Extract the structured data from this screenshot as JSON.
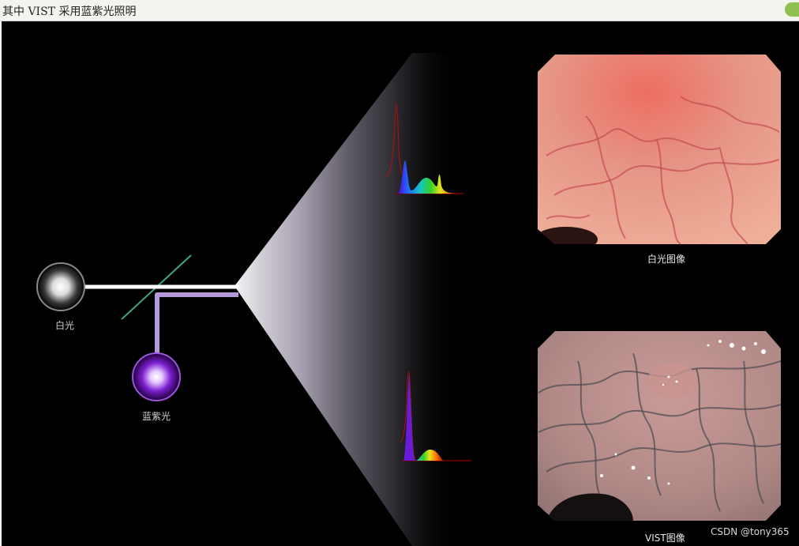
{
  "header": {
    "caption": "其中 VIST 采用蓝紫光照明"
  },
  "sources": {
    "white_light": "白光",
    "blue_violet_light": "蓝紫光"
  },
  "images": {
    "white_light_image": "白光图像",
    "vist_image": "VIST图像"
  },
  "watermark": "CSDN @tony365",
  "colors": {
    "background": "#000000",
    "white_beam": "#ffffff",
    "violet_beam": "#b49ad8",
    "violet_source": "#8a2be2",
    "splitter": "#3fa77a",
    "mucosa_white": "#e07a6c",
    "mucosa_vist": "#b88a8a",
    "header_bg": "#f4f3ef"
  },
  "icons": [
    "status-dot-icon"
  ]
}
